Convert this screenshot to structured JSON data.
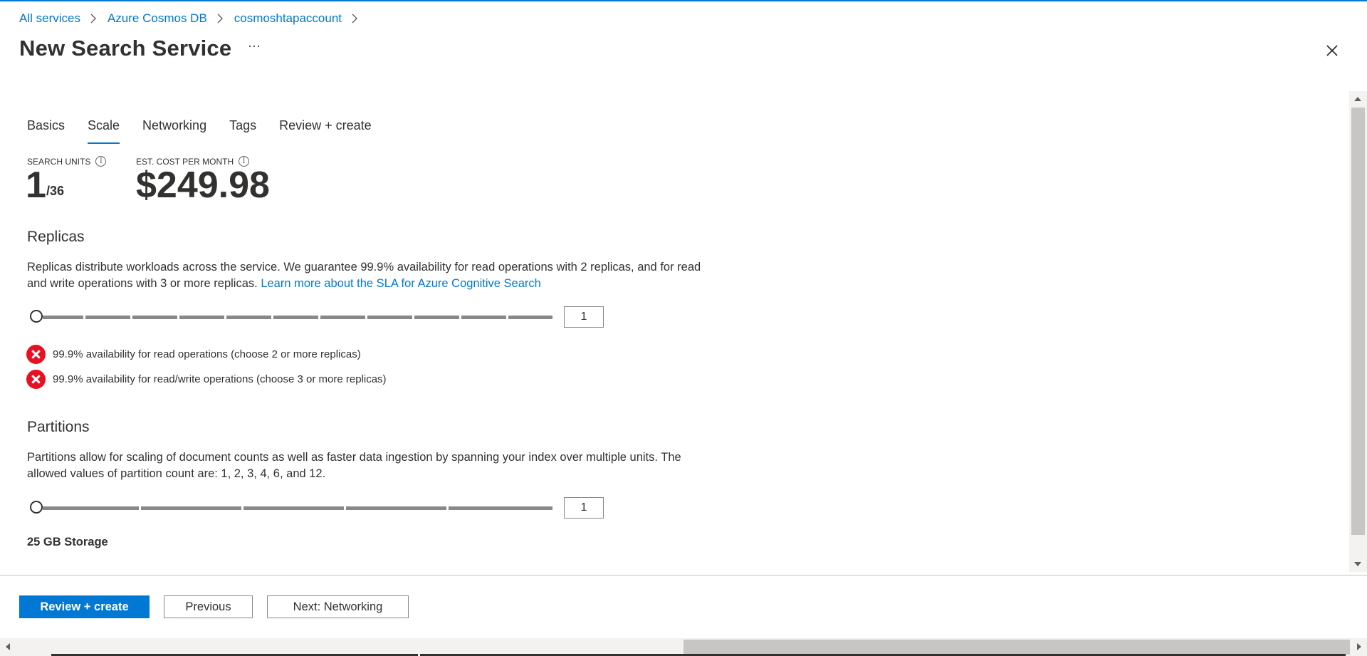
{
  "breadcrumb": [
    {
      "label": "All services"
    },
    {
      "label": "Azure Cosmos DB"
    },
    {
      "label": "cosmoshtapaccount"
    }
  ],
  "page": {
    "title": "New Search Service",
    "more_label": "···"
  },
  "tabs": [
    {
      "label": "Basics",
      "active": false
    },
    {
      "label": "Scale",
      "active": true
    },
    {
      "label": "Networking",
      "active": false
    },
    {
      "label": "Tags",
      "active": false
    },
    {
      "label": "Review + create",
      "active": false
    }
  ],
  "summary": {
    "search_units_label": "SEARCH UNITS",
    "search_units_value": "1",
    "search_units_max": "/36",
    "cost_label": "EST. COST PER MONTH",
    "cost_value": "$249.98",
    "info_glyph": "i"
  },
  "replicas": {
    "title": "Replicas",
    "description": "Replicas distribute workloads across the service. We guarantee 99.9% availability for read operations with 2 replicas, and for read and write operations with 3 or more replicas.",
    "link": "Learn more about the SLA for Azure Cognitive Search",
    "value": "1",
    "slider": {
      "min": 1,
      "max": 12,
      "value": 1
    },
    "statuses": [
      {
        "text": "99.9% availability for read operations (choose 2 or more replicas)",
        "icon": "error-icon",
        "color": "#e81123"
      },
      {
        "text": "99.9% availability for read/write operations (choose 3 or more replicas)",
        "icon": "error-icon",
        "color": "#e81123"
      }
    ]
  },
  "partitions": {
    "title": "Partitions",
    "description": "Partitions allow for scaling of document counts as well as faster data ingestion by spanning your index over multiple units. The allowed values of partition count are: 1, 2, 3, 4, 6, and 12.",
    "value": "1",
    "slider": {
      "allowed": [
        1,
        2,
        3,
        4,
        6,
        12
      ],
      "value": 1
    },
    "storage": "25 GB Storage"
  },
  "footer": {
    "review_label": "Review + create",
    "previous_label": "Previous",
    "next_label": "Next: Networking"
  },
  "colors": {
    "accent": "#0078d4",
    "error": "#e81123"
  }
}
